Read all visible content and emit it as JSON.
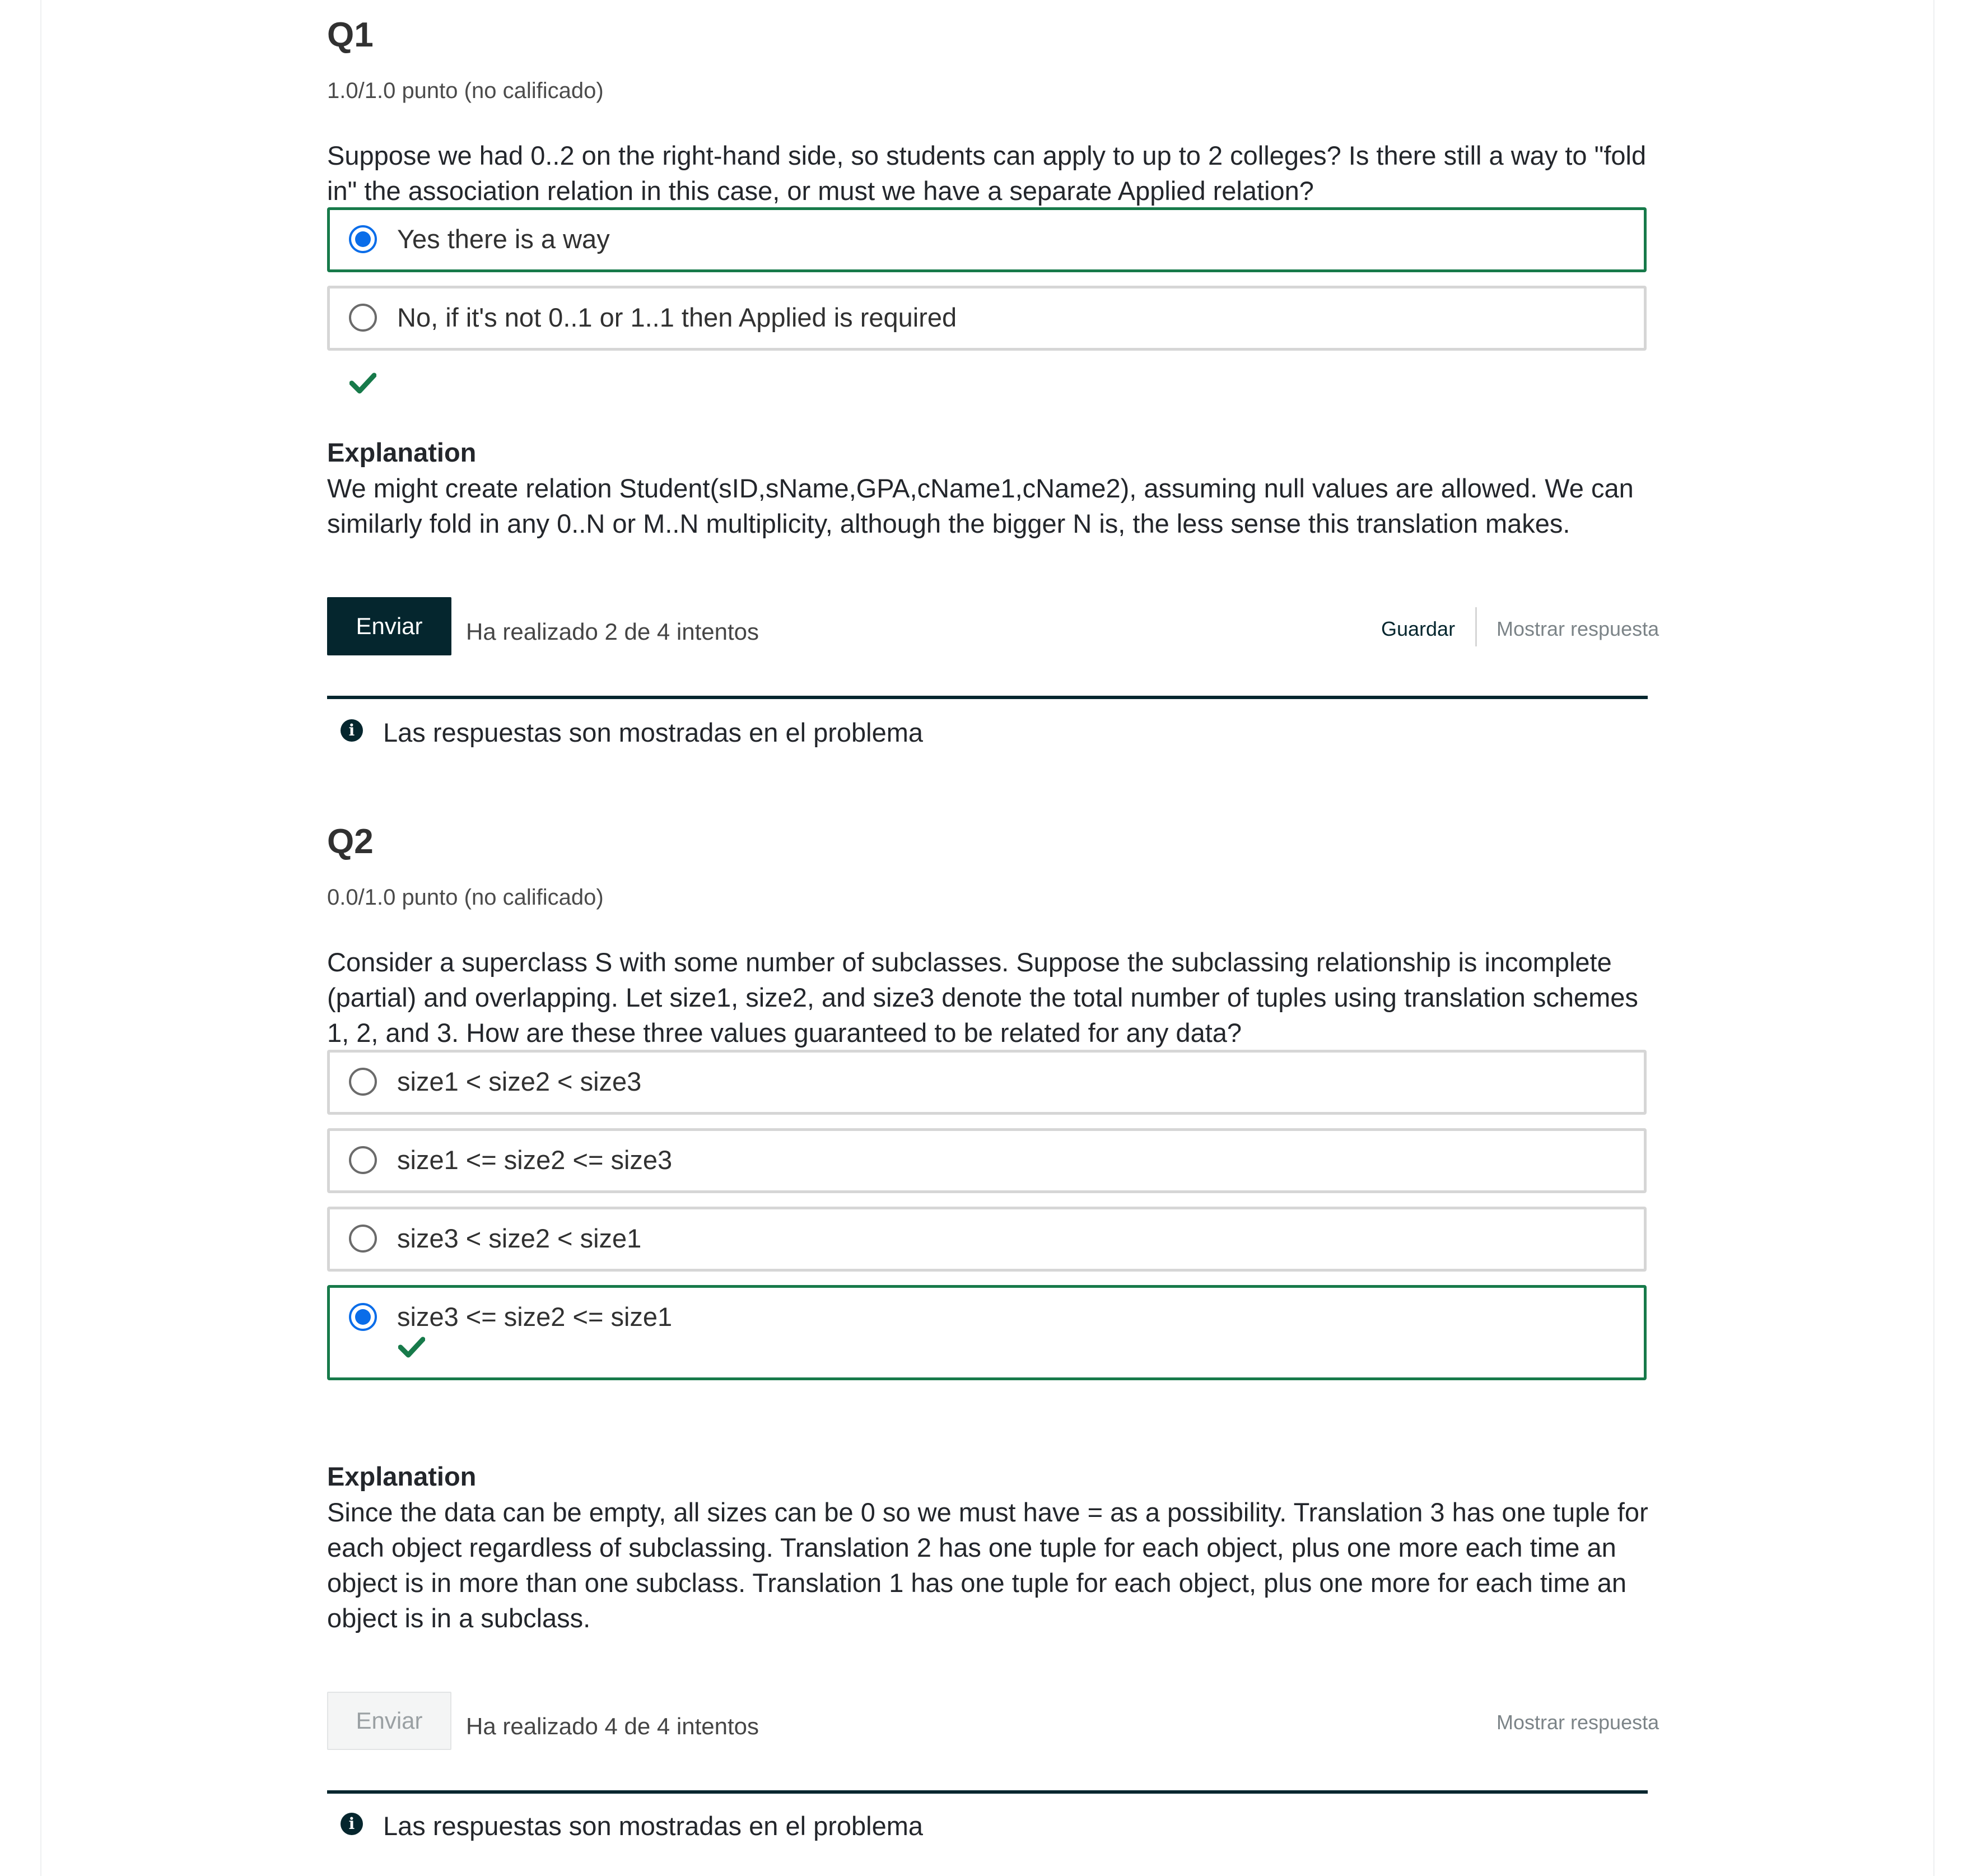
{
  "problems": [
    {
      "title": "Q1",
      "points": "1.0/1.0 punto (no calificado)",
      "question": "Suppose we had 0..2 on the right-hand side, so students can apply to up to 2 colleges? Is there still a way to \"fold in\" the association relation in this case, or must we have a separate Applied relation?",
      "choices": [
        {
          "label": "Yes there is a way",
          "selected": true
        },
        {
          "label": "No, if it's not 0..1 or 1..1 then Applied is required",
          "selected": false
        }
      ],
      "explanation_title": "Explanation",
      "explanation": "We might create relation Student(sID,sName,GPA,cName1,cName2), assuming null values are allowed. We can similarly fold in any 0..N or M..N multiplicity, although the bigger N is, the less sense this translation makes.",
      "submit_label": "Enviar",
      "attempts": "Ha realizado 2 de 4 intentos",
      "save_label": "Guardar",
      "show_answer_label": "Mostrar respuesta",
      "notification": "Las respuestas son mostradas en el problema"
    },
    {
      "title": "Q2",
      "points": "0.0/1.0 punto (no calificado)",
      "question": "Consider a superclass S with some number of subclasses. Suppose the subclassing relationship is incomplete (partial) and overlapping. Let size1, size2, and size3 denote the total number of tuples using translation schemes 1, 2, and 3. How are these three values guaranteed to be related for any data?",
      "choices": [
        {
          "label": "size1 < size2 < size3",
          "selected": false
        },
        {
          "label": "size1 <= size2 <= size3",
          "selected": false
        },
        {
          "label": "size3 < size2 < size1",
          "selected": false
        },
        {
          "label": "size3 <= size2 <= size1",
          "selected": true
        }
      ],
      "explanation_title": "Explanation",
      "explanation": "Since the data can be empty, all sizes can be 0 so we must have = as a possibility. Translation 3 has one tuple for each object regardless of subclassing. Translation 2 has one tuple for each object, plus one more each time an object is in more than one subclass. Translation 1 has one tuple for each object, plus one more for each time an object is in a subclass.",
      "submit_label": "Enviar",
      "attempts": "Ha realizado 4 de 4 intentos",
      "show_answer_label": "Mostrar respuesta",
      "notification": "Las respuestas son mostradas en el problema"
    }
  ],
  "colors": {
    "correct_border": "#177a4a",
    "radio_selected": "#0a6de9",
    "primary_button": "#05262e"
  },
  "icons": [
    "checkmark-icon",
    "info-icon"
  ]
}
